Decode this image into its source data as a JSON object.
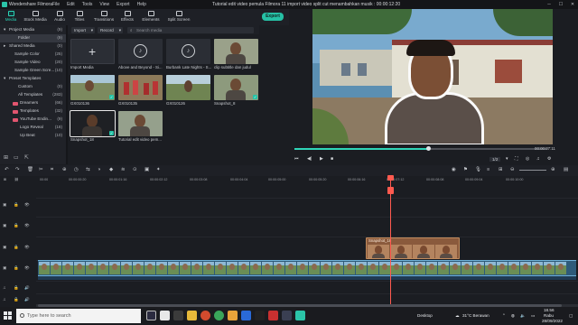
{
  "titlebar": {
    "app_name": "Wondershare Filmora",
    "menus": [
      "File",
      "Edit",
      "Tools",
      "View",
      "Export",
      "Help"
    ],
    "document_title": "Tutorial edit video pemula Filmora 11 import video split cut menambahkan musik : 00:00:12:20"
  },
  "tool_tabs": [
    {
      "label": "Media",
      "icon": "media-icon"
    },
    {
      "label": "Stock Media",
      "icon": "stock-media-icon"
    },
    {
      "label": "Audio",
      "icon": "audio-icon"
    },
    {
      "label": "Titles",
      "icon": "titles-icon"
    },
    {
      "label": "Transitions",
      "icon": "transitions-icon"
    },
    {
      "label": "Effects",
      "icon": "effects-icon"
    },
    {
      "label": "Elements",
      "icon": "elements-icon"
    },
    {
      "label": "Split Screen",
      "icon": "split-screen-icon"
    }
  ],
  "export_label": "Export",
  "left_panel": {
    "items": [
      {
        "label": "Project Media",
        "count": "(9)",
        "indent": "header"
      },
      {
        "label": "Folder",
        "count": "(9)",
        "indent": "child",
        "selected": true
      },
      {
        "label": "Shared Media",
        "count": "(0)",
        "indent": "header"
      },
      {
        "label": "Sample Color",
        "count": "(25)",
        "indent": "child"
      },
      {
        "label": "Sample Video",
        "count": "(20)",
        "indent": "child"
      },
      {
        "label": "Sample Green Scre...",
        "count": "(10)",
        "indent": "child"
      },
      {
        "label": "Preset Templates",
        "count": "",
        "indent": "header"
      },
      {
        "label": "Custom",
        "count": "(0)",
        "indent": "child"
      },
      {
        "label": "All Templates",
        "count": "(283)",
        "indent": "child"
      },
      {
        "label": "Dreamers",
        "count": "(66)",
        "indent": "folder",
        "folder_color": "#e2556f"
      },
      {
        "label": "Templates",
        "count": "(32)",
        "indent": "folder",
        "folder_color": "#e2556f"
      },
      {
        "label": "YouTube Endin...",
        "count": "(9)",
        "indent": "folder",
        "folder_color": "#e2556f"
      },
      {
        "label": "Logo Reveal",
        "count": "(18)",
        "indent": "child"
      },
      {
        "label": "Up Beat",
        "count": "(10)",
        "indent": "child"
      }
    ],
    "footer_icons": [
      "add-folder-icon",
      "new-folder-icon",
      "folder-up-icon"
    ]
  },
  "media_toolbar": {
    "import_label": "Import",
    "record_label": "Record",
    "search_placeholder": "Search media"
  },
  "media_items": [
    {
      "label": "Import Media",
      "kind": "import"
    },
    {
      "label": "Above and Beyond - Si...",
      "kind": "audio"
    },
    {
      "label": "Burbank Late Nights - S...",
      "kind": "audio"
    },
    {
      "label": "clip subtitle dan judul",
      "kind": "video",
      "scene": "man"
    },
    {
      "label": "GX010136",
      "kind": "video",
      "scene": "field",
      "checked": true
    },
    {
      "label": "GX010135",
      "kind": "video",
      "scene": "crowd"
    },
    {
      "label": "GX010126",
      "kind": "video",
      "scene": "field"
    },
    {
      "label": "Snapshot_8",
      "kind": "video",
      "scene": "man",
      "checked": true
    },
    {
      "label": "Snapshot_18",
      "kind": "video",
      "scene": "dark",
      "checked": true,
      "selected": true
    },
    {
      "label": "Tutorial edit video pem...",
      "kind": "video",
      "scene": "man"
    }
  ],
  "preview": {
    "timecode": "00:00:07:11",
    "progress_fraction": 0.53,
    "zoom_label": "1/2"
  },
  "timeline": {
    "ruler_ticks": [
      "00:00",
      "00:00:00:20",
      "00:00:01:16",
      "00:00:02:12",
      "00:00:03:08",
      "00:00:04:04",
      "00:00:05:00",
      "00:00:05:20",
      "00:00:06:16",
      "00:00:07:12",
      "00:00:08:08",
      "00:00:09:04",
      "00:00:10:00"
    ],
    "overlay_clip_label": "Snapshot_18",
    "main_clip_label": "GX010136"
  },
  "taskbar": {
    "search_placeholder": "Type here to search",
    "desktop_label": "Desktop",
    "weather": "31°C Berawan",
    "time": "18.56",
    "day": "Rabu",
    "date": "28/09/2022"
  }
}
